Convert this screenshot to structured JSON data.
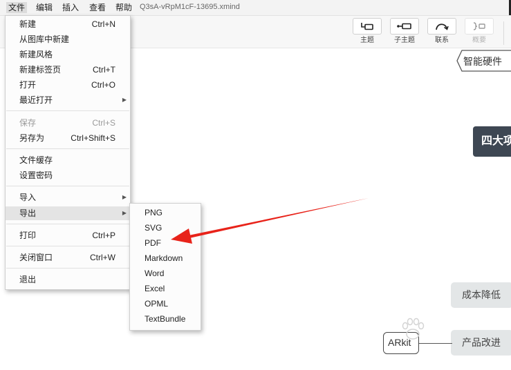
{
  "menubar": {
    "items": [
      "文件",
      "编辑",
      "插入",
      "查看",
      "帮助"
    ],
    "document_title": "Q3sA-vRpM1cF-13695.xmind"
  },
  "toolbar": {
    "buttons": [
      {
        "label": "主题",
        "icon": "topic-icon",
        "disabled": false
      },
      {
        "label": "子主题",
        "icon": "subtopic-icon",
        "disabled": false
      },
      {
        "label": "联系",
        "icon": "relationship-icon",
        "disabled": false
      },
      {
        "label": "概要",
        "icon": "summary-icon",
        "disabled": true
      }
    ]
  },
  "file_menu": {
    "items": [
      {
        "label": "新建",
        "shortcut": "Ctrl+N"
      },
      {
        "label": "从图库中新建",
        "shortcut": ""
      },
      {
        "label": "新建风格",
        "shortcut": ""
      },
      {
        "label": "新建标签页",
        "shortcut": "Ctrl+T"
      },
      {
        "label": "打开",
        "shortcut": "Ctrl+O"
      },
      {
        "label": "最近打开",
        "shortcut": "",
        "submenu": true
      },
      {
        "label": "保存",
        "shortcut": "Ctrl+S",
        "disabled": true
      },
      {
        "label": "另存为",
        "shortcut": "Ctrl+Shift+S"
      },
      {
        "label": "文件缓存",
        "shortcut": ""
      },
      {
        "label": "设置密码",
        "shortcut": ""
      },
      {
        "label": "导入",
        "shortcut": "",
        "submenu": true
      },
      {
        "label": "导出",
        "shortcut": "",
        "submenu": true,
        "highlighted": true
      },
      {
        "label": "打印",
        "shortcut": "Ctrl+P"
      },
      {
        "label": "关闭窗口",
        "shortcut": "Ctrl+W"
      },
      {
        "label": "退出",
        "shortcut": ""
      }
    ]
  },
  "export_submenu": {
    "items": [
      "PNG",
      "SVG",
      "PDF",
      "Markdown",
      "Word",
      "Excel",
      "OPML",
      "TextBundle"
    ]
  },
  "canvas": {
    "topics": {
      "smart_hardware": "智能硬件",
      "four_major": "四大项",
      "cost_reduction": "成本降低",
      "arkit": "ARkit",
      "product_improvement": "产品改进"
    }
  },
  "annotation": {
    "arrow_color": "#e8231a",
    "points_to": "PDF"
  },
  "colors": {
    "dark_topic": "#3e4753",
    "grey_topic": "#e3e6e7",
    "menu_highlight": "#e4e4e4"
  }
}
